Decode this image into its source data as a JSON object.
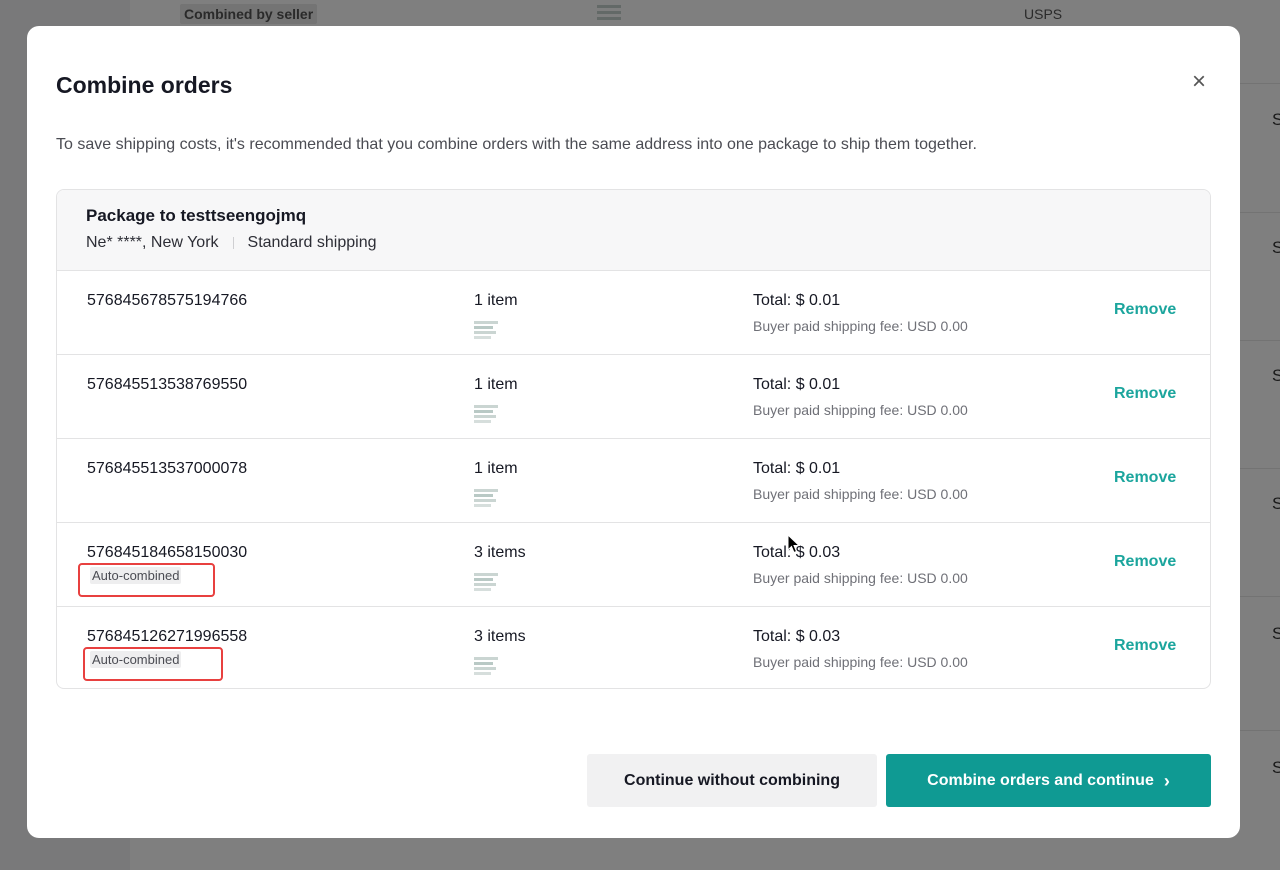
{
  "background": {
    "tag": "Combined by seller",
    "carrier": "USPS",
    "right_edge_letter": "S"
  },
  "modal": {
    "title": "Combine orders",
    "close_icon": "close-icon",
    "description": "To save shipping costs, it's recommended that you combine orders with the same address into one package to ship them together."
  },
  "package": {
    "title": "Package to testtseengojmq",
    "address": "Ne* ****, New York",
    "shipping_method": "Standard shipping"
  },
  "orders": [
    {
      "id": "576845678575194766",
      "items": "1 item",
      "total": "Total: $ 0.01",
      "shipping_fee": "Buyer paid shipping fee: USD 0.00",
      "remove": "Remove",
      "tag": ""
    },
    {
      "id": "576845513538769550",
      "items": "1 item",
      "total": "Total: $ 0.01",
      "shipping_fee": "Buyer paid shipping fee: USD 0.00",
      "remove": "Remove",
      "tag": ""
    },
    {
      "id": "576845513537000078",
      "items": "1 item",
      "total": "Total: $ 0.01",
      "shipping_fee": "Buyer paid shipping fee: USD 0.00",
      "remove": "Remove",
      "tag": ""
    },
    {
      "id": "576845184658150030",
      "items": "3 items",
      "total": "Total: $ 0.03",
      "shipping_fee": "Buyer paid shipping fee: USD 0.00",
      "remove": "Remove",
      "tag": "Auto-combined"
    },
    {
      "id": "576845126271996558",
      "items": "3 items",
      "total": "Total: $ 0.03",
      "shipping_fee": "Buyer paid shipping fee: USD 0.00",
      "remove": "Remove",
      "tag": "Auto-combined"
    }
  ],
  "buttons": {
    "secondary": "Continue without combining",
    "primary": "Combine orders and continue",
    "primary_icon": "chevron-right-icon"
  },
  "colors": {
    "accent": "#0f9a93",
    "link": "#1ba59d",
    "highlight": "#e8403f"
  }
}
